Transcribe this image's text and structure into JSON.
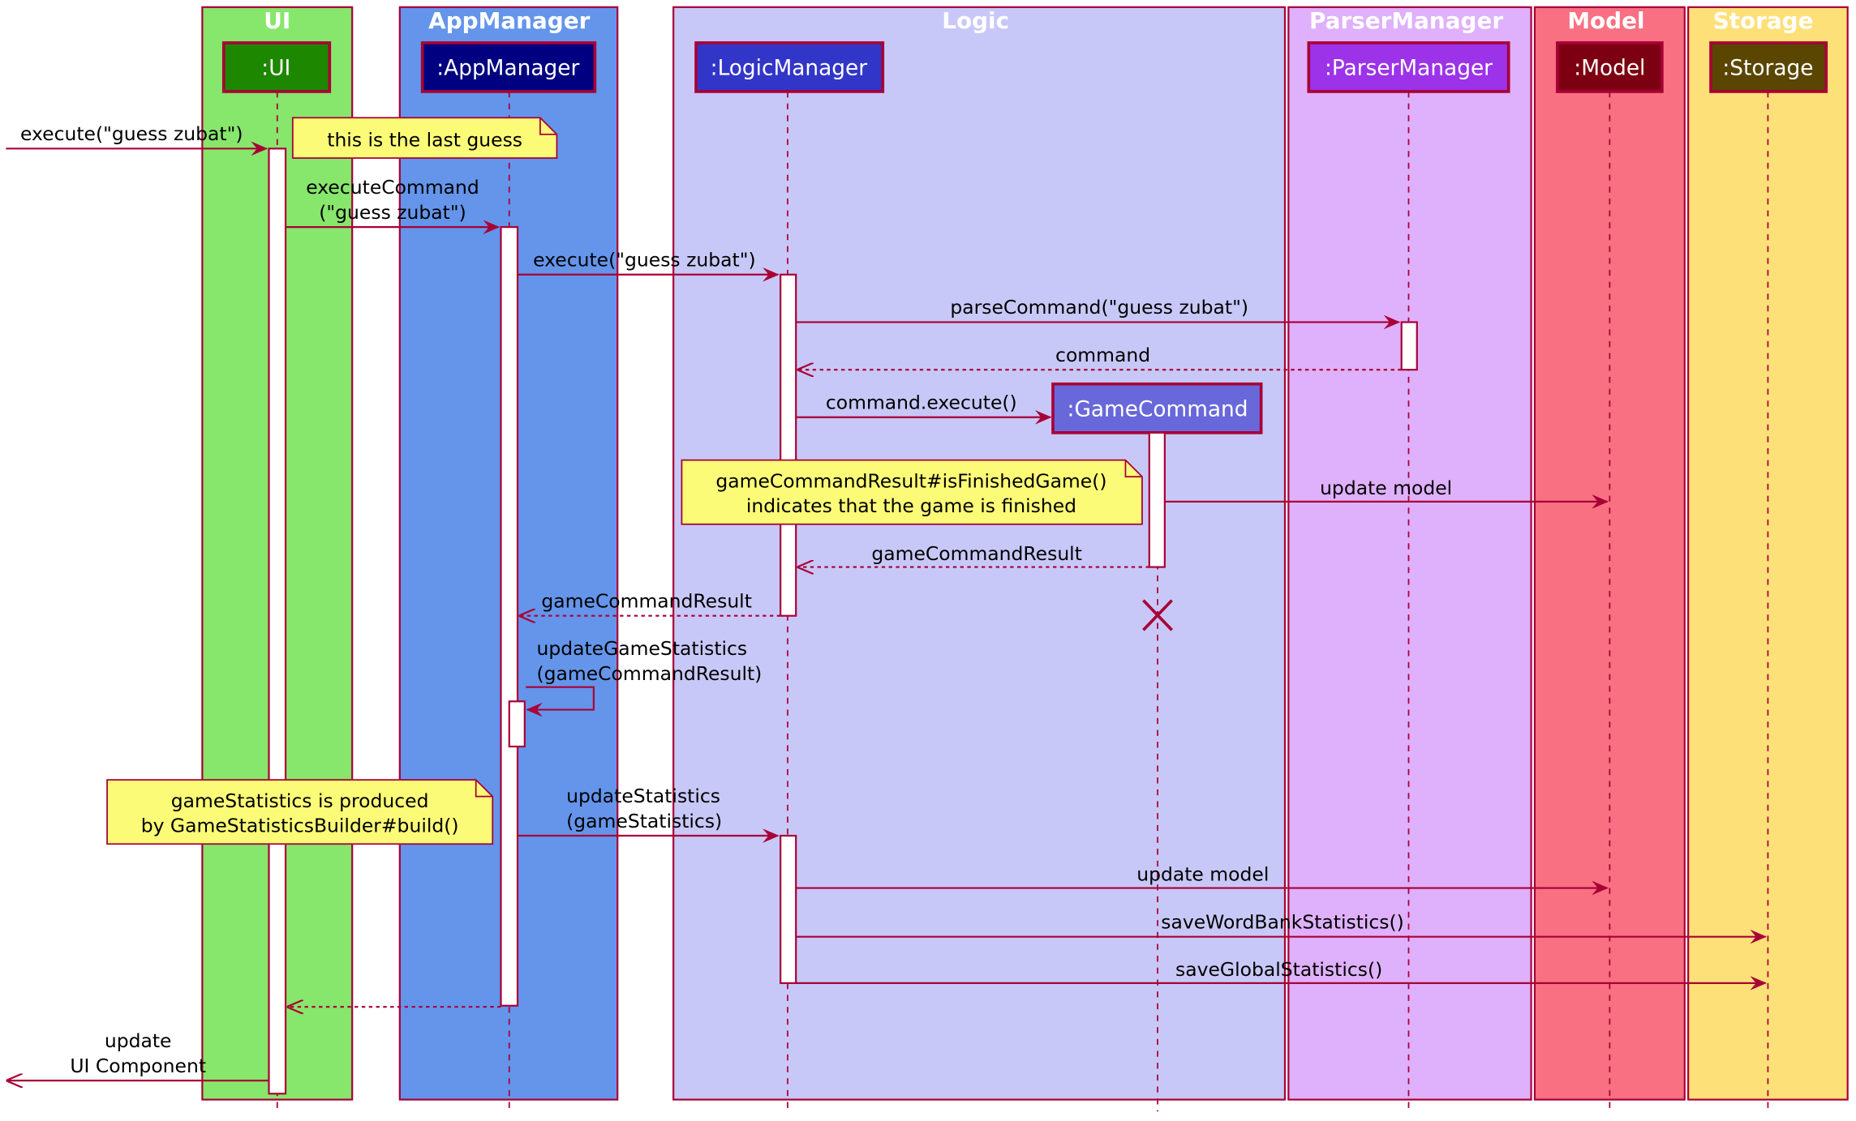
{
  "diagram_type": "UML sequence diagram",
  "colors": {
    "border": "#A80036",
    "arrow": "#A80036",
    "note_fill": "#FBFB77",
    "activation_fill": "#FFFFFF"
  },
  "boxes": [
    {
      "id": "ui",
      "title": "UI",
      "fill": "#87E66C"
    },
    {
      "id": "app",
      "title": "AppManager",
      "fill": "#6495EB"
    },
    {
      "id": "logic",
      "title": "Logic",
      "fill": "#C8C8F8"
    },
    {
      "id": "parser",
      "title": "ParserManager",
      "fill": "#DFB0FB"
    },
    {
      "id": "model",
      "title": "Model",
      "fill": "#F87082"
    },
    {
      "id": "storage",
      "title": "Storage",
      "fill": "#FEE079"
    }
  ],
  "participants": [
    {
      "id": "ui",
      "label": ":UI",
      "fill": "#1E8700"
    },
    {
      "id": "app",
      "label": ":AppManager",
      "fill": "#000080"
    },
    {
      "id": "logic",
      "label": ":LogicManager",
      "fill": "#3236C8"
    },
    {
      "id": "parser",
      "label": ":ParserManager",
      "fill": "#9C33E8"
    },
    {
      "id": "model",
      "label": ":Model",
      "fill": "#7D0012"
    },
    {
      "id": "storage",
      "label": ":Storage",
      "fill": "#5A4600"
    },
    {
      "id": "gamecmd",
      "label": ":GameCommand",
      "fill": "#6868DB",
      "created": true,
      "destroyed": true
    }
  ],
  "messages": [
    {
      "from": "external",
      "to": "ui",
      "label": [
        "execute(\"guess zubat\")"
      ],
      "style": "sync"
    },
    {
      "from": "ui",
      "to": "app",
      "label": [
        "executeCommand",
        "(\"guess zubat\")"
      ],
      "style": "sync"
    },
    {
      "from": "app",
      "to": "logic",
      "label": [
        "execute(\"guess zubat\")"
      ],
      "style": "sync"
    },
    {
      "from": "logic",
      "to": "parser",
      "label": [
        "parseCommand(\"guess zubat\")"
      ],
      "style": "sync"
    },
    {
      "from": "parser",
      "to": "logic",
      "label": [
        "command"
      ],
      "style": "return"
    },
    {
      "from": "logic",
      "to": "gamecmd",
      "label": [
        "command.execute()"
      ],
      "style": "create"
    },
    {
      "from": "gamecmd",
      "to": "model",
      "label": [
        "update model"
      ],
      "style": "sync"
    },
    {
      "from": "gamecmd",
      "to": "logic",
      "label": [
        "gameCommandResult"
      ],
      "style": "return"
    },
    {
      "from": "logic",
      "to": "app",
      "label": [
        "gameCommandResult"
      ],
      "style": "return"
    },
    {
      "from": "app",
      "to": "app",
      "label": [
        "updateGameStatistics",
        "(gameCommandResult)"
      ],
      "style": "self"
    },
    {
      "from": "app",
      "to": "logic",
      "label": [
        "updateStatistics",
        "(gameStatistics)"
      ],
      "style": "sync"
    },
    {
      "from": "logic",
      "to": "model",
      "label": [
        "update model"
      ],
      "style": "sync"
    },
    {
      "from": "logic",
      "to": "storage",
      "label": [
        "saveWordBankStatistics()"
      ],
      "style": "sync"
    },
    {
      "from": "logic",
      "to": "storage",
      "label": [
        "saveGlobalStatistics()"
      ],
      "style": "sync"
    },
    {
      "from": "app",
      "to": "ui",
      "label": [
        ""
      ],
      "style": "return"
    },
    {
      "from": "ui",
      "to": "external",
      "label": [
        "update",
        "UI Component"
      ],
      "style": "sync"
    }
  ],
  "notes": [
    {
      "id": "note-last-guess",
      "lines": [
        "this is the last guess"
      ]
    },
    {
      "id": "note-finished",
      "lines": [
        "gameCommandResult#isFinishedGame()",
        "indicates that the game is finished"
      ]
    },
    {
      "id": "note-statistics",
      "lines": [
        "gameStatistics is produced",
        "by GameStatisticsBuilder#build()"
      ]
    }
  ]
}
